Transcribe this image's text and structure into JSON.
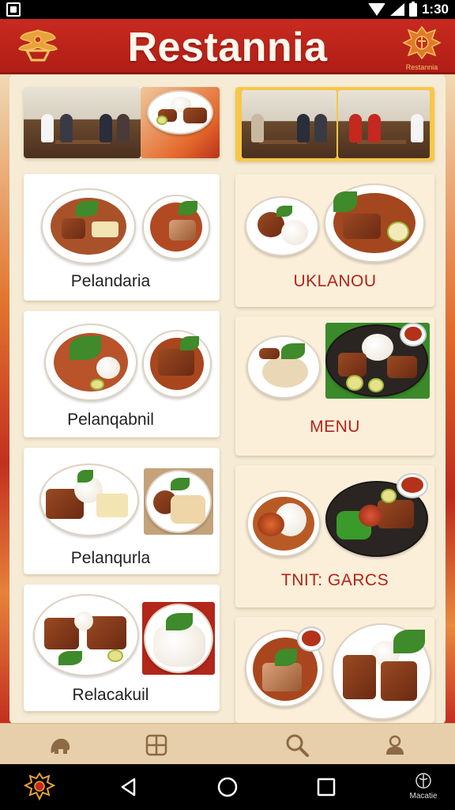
{
  "status_bar": {
    "time": "1:30"
  },
  "header": {
    "title": "Restannia",
    "right_logo_caption": "Restannia"
  },
  "left_column": [
    {
      "label": "Pelandaria"
    },
    {
      "label": "Pelanqabnil"
    },
    {
      "label": "Pelanqurla"
    },
    {
      "label": "Relacakuil"
    }
  ],
  "right_column": [
    {
      "label": "UKLANOU"
    },
    {
      "label": "MENU"
    },
    {
      "label": "TNIT: GARCS"
    },
    {
      "label": ""
    }
  ],
  "bottom_nav": [
    {
      "icon": "home-icon"
    },
    {
      "icon": "menu-grid-icon"
    },
    {
      "icon": "search-icon"
    },
    {
      "icon": "profile-icon"
    }
  ],
  "system_bar": {
    "right_caption": "Macatie"
  },
  "colors": {
    "header_red": "#c82a1f",
    "label_red": "#b3231a",
    "cream": "#fcefd9",
    "nav_beige": "#e7cfab"
  }
}
